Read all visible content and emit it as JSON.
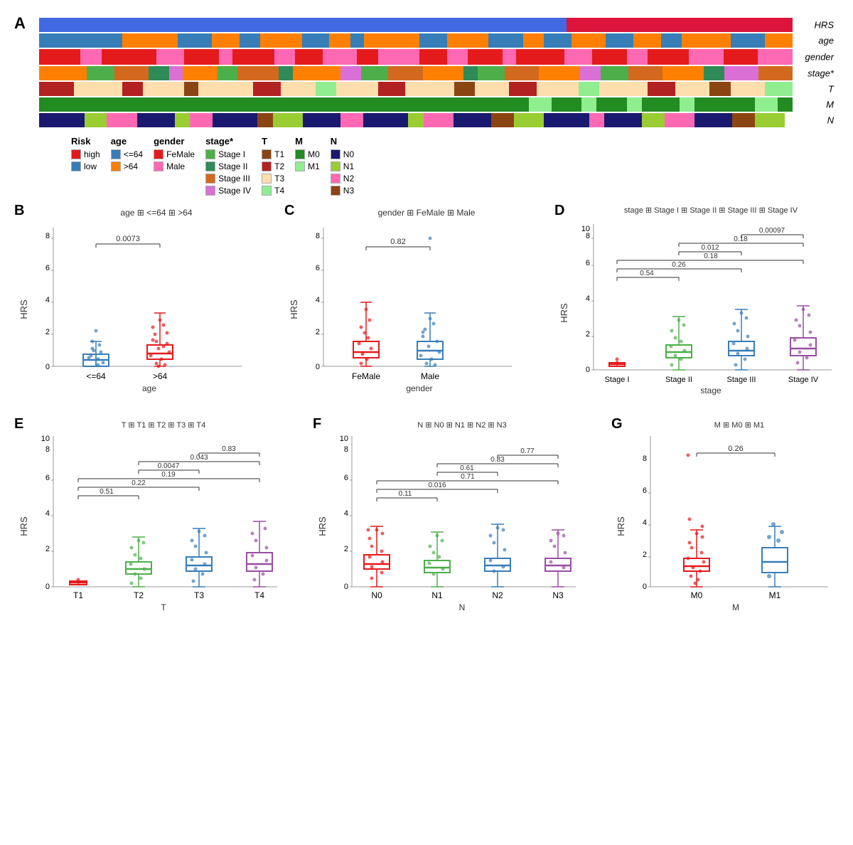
{
  "figure": {
    "panel_a_label": "A",
    "panel_b_label": "B",
    "panel_c_label": "C",
    "panel_d_label": "D",
    "panel_e_label": "E",
    "panel_f_label": "F",
    "panel_g_label": "G"
  },
  "legend": {
    "risk_title": "Risk",
    "risk_items": [
      {
        "label": "high",
        "color": "#E41A1C"
      },
      {
        "label": "low",
        "color": "#377EB8"
      }
    ],
    "age_title": "age",
    "age_items": [
      {
        "label": "<=64",
        "color": "#377EB8"
      },
      {
        "label": ">64",
        "color": "#FF7F00"
      }
    ],
    "gender_title": "gender",
    "gender_items": [
      {
        "label": "FeMale",
        "color": "#E41A1C"
      },
      {
        "label": "Male",
        "color": "#FF69B4"
      }
    ],
    "stage_title": "stage*",
    "stage_items": [
      {
        "label": "Stage I",
        "color": "#4DAF4A"
      },
      {
        "label": "Stage II",
        "color": "#2E8B57"
      },
      {
        "label": "Stage III",
        "color": "#D2691E"
      },
      {
        "label": "Stage IV",
        "color": "#DA70D6"
      }
    ],
    "T_title": "T",
    "T_items": [
      {
        "label": "T1",
        "color": "#8B4513"
      },
      {
        "label": "T2",
        "color": "#B22222"
      },
      {
        "label": "T3",
        "color": "#FFDEAD"
      },
      {
        "label": "T4",
        "color": "#90EE90"
      }
    ],
    "M_title": "M",
    "M_items": [
      {
        "label": "M0",
        "color": "#228B22"
      },
      {
        "label": "M1",
        "color": "#90EE90"
      }
    ],
    "N_title": "N",
    "N_items": [
      {
        "label": "N0",
        "color": "#191970"
      },
      {
        "label": "N1",
        "color": "#9ACD32"
      },
      {
        "label": "N2",
        "color": "#FF69B4"
      },
      {
        "label": "N3",
        "color": "#8B4513"
      }
    ]
  },
  "plot_b": {
    "title_age": "age",
    "legend_le64": "<=64",
    "legend_gt64": ">64",
    "pvalue": "0.0073",
    "x_label": "age",
    "y_label": "HRS",
    "x_ticks": [
      "<=64",
      ">64"
    ]
  },
  "plot_c": {
    "title_gender": "gender",
    "legend_female": "FeMale",
    "legend_male": "Male",
    "pvalue": "0.82",
    "x_label": "gender",
    "y_label": "HRS",
    "x_ticks": [
      "FeMale",
      "Male"
    ]
  },
  "plot_d": {
    "title_stage": "stage",
    "pvalues": [
      "0.54",
      "0.26",
      "0.18",
      "0.012",
      "0.18",
      "0.00097"
    ],
    "x_label": "stage",
    "y_label": "HRS",
    "x_ticks": [
      "Stage I",
      "Stage II",
      "Stage III",
      "Stage IV"
    ]
  },
  "plot_e": {
    "title_T": "T",
    "pvalues": [
      "0.51",
      "0.22",
      "0.19",
      "0.0047",
      "0.043",
      "0.83"
    ],
    "x_label": "T",
    "y_label": "HRS",
    "x_ticks": [
      "T1",
      "T2",
      "T3",
      "T4"
    ]
  },
  "plot_f": {
    "title_N": "N",
    "pvalues": [
      "0.11",
      "0.016",
      "0.71",
      "0.61",
      "0.83",
      "0.77"
    ],
    "x_label": "N",
    "y_label": "HRS",
    "x_ticks": [
      "N0",
      "N1",
      "N2",
      "N3"
    ]
  },
  "plot_g": {
    "title_M": "M",
    "pvalue": "0.26",
    "x_label": "M",
    "y_label": "HRS",
    "x_ticks": [
      "M0",
      "M1"
    ]
  }
}
